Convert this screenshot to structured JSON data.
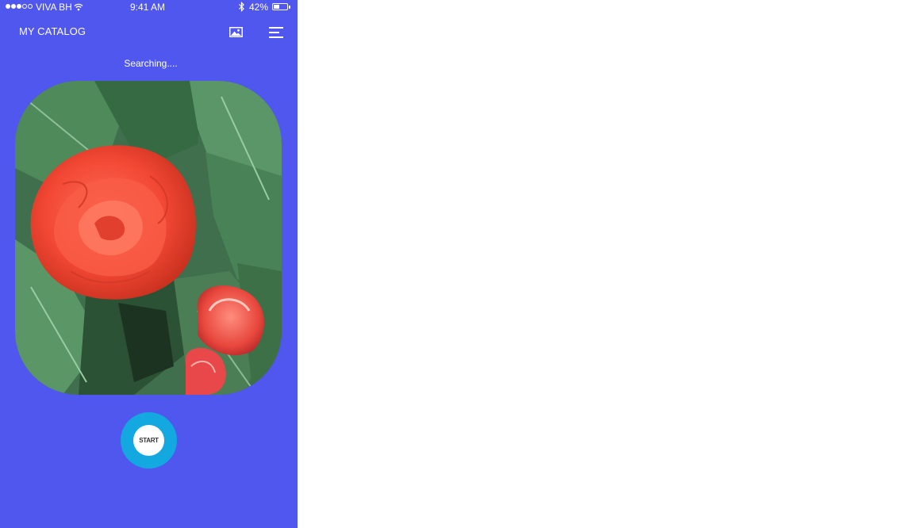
{
  "status_bar": {
    "carrier": "VIVA BH",
    "signal_bars_filled": 3,
    "signal_bars_total": 5,
    "time": "9:41 AM",
    "battery_percent": "42%",
    "battery_level": 0.42
  },
  "nav": {
    "title": "MY CATALOG",
    "image_icon": "image-icon",
    "menu_icon": "menu-icon"
  },
  "main": {
    "status_text": "Searching....",
    "start_label": "START"
  },
  "colors": {
    "background": "#4f57ee",
    "start_ring": "#14a8e0",
    "page": "#ffffff"
  }
}
